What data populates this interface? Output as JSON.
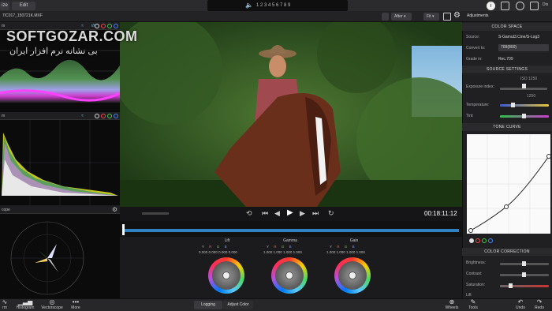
{
  "topbar": {
    "mode_left": "ize",
    "edit_tab": "Edit",
    "timecode_icon": "speaker-icon",
    "timecode_text": "1  2  3  4  5  6  7  8  9"
  },
  "file": {
    "name": "7/C017_150721K.MXF"
  },
  "toolbar": {
    "after_label": "After",
    "fit_label": "Fit"
  },
  "panels": {
    "waveform_title": "m",
    "histogram_title": "m",
    "vectorscope_title": "cope"
  },
  "playback": {
    "timecode": "00:18:11:12"
  },
  "wheels": [
    {
      "name": "Lift",
      "values": [
        "0.000",
        "0.000",
        "0.000",
        "0.000"
      ]
    },
    {
      "name": "Gamma",
      "values": [
        "1.000",
        "1.000",
        "1.000",
        "1.000"
      ]
    },
    {
      "name": "Gain",
      "values": [
        "1.000",
        "1.000",
        "1.000",
        "1.000"
      ]
    }
  ],
  "wheel_channels": [
    "Y",
    "R",
    "G",
    "B"
  ],
  "adjustments": {
    "title": "Adjustments",
    "color_space": "COLOR SPACE",
    "source_label": "Source:",
    "source_value": "S-Gamut3.Cine/S-Log3",
    "convert_label": "Convert to:",
    "convert_value": "709(800)",
    "grade_label": "Grade in:",
    "grade_value": "Rec.709",
    "source_settings": "SOURCE SETTINGS",
    "exposure_label": "Exposure index:",
    "exposure_value": "ISO 1250",
    "exposure_sub": "1250",
    "temperature_label": "Temperature:",
    "tint_label": "Tint:",
    "tone_curve": "TONE CURVE",
    "color_correction": "COLOR CORRECTION",
    "brightness_label": "Brightness:",
    "contrast_label": "Contrast:",
    "saturation_label": "Saturation:",
    "lift_label": "Lift"
  },
  "bottom": {
    "waveform": "rm",
    "histogram": "Histogram",
    "vectorscope": "Vectorscope",
    "more": "More",
    "logging": "Logging",
    "adjust_color": "Adjust Color",
    "wheels": "Wheels",
    "tools": "Tools",
    "undo": "Undo",
    "redo": "Redo"
  },
  "watermark": {
    "brand": "SOFTGOZAR.COM",
    "tagline": "بی نشانه نرم افزار ایران"
  }
}
